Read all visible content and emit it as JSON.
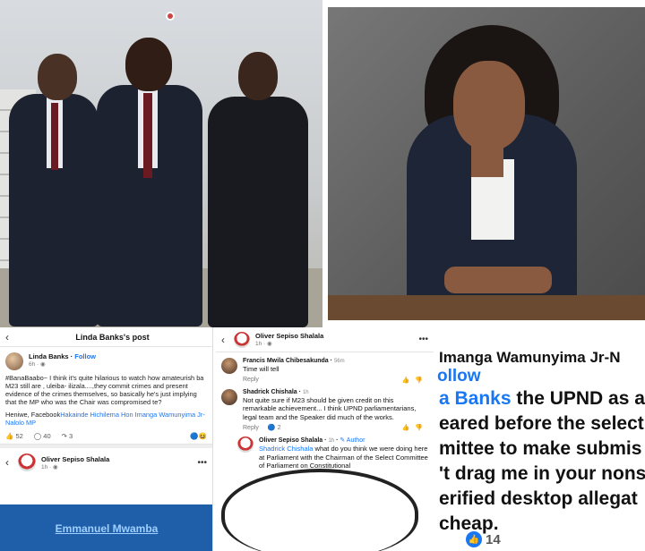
{
  "left_post": {
    "header_title": "Linda Banks's post",
    "author": "Linda Banks",
    "follow": "Follow",
    "time": "6h",
    "text": "#BanaBaabo~ I think it's quite hilarious to watch how amateurish ba M23  still are , uleiba- ilizala....,they commit crimes and present evidence of the crimes themselves, so basically he's just implying that the MP who was the Chair was compromised te?",
    "text2_prefix": "Heniwe, Facebook",
    "text2_mention": "Hakainde Hichilema Hon Imanga Wamunyima Jr-Nalolo MP",
    "likes": "52",
    "comments": "40",
    "shares": "3",
    "share_author": "Oliver Sepiso Shalala",
    "share_time": "1h",
    "blue_text": "Emmanuel Mwamba"
  },
  "comments": {
    "top_author": "Oliver Sepiso Shalala",
    "top_time": "1h",
    "items": [
      {
        "name": "Francis Mwila Chibesakunda",
        "time": "56m",
        "text": "Time will tell",
        "reply": "Reply"
      },
      {
        "name": "Shadrick Chishala",
        "time": "1h",
        "text": "Not quite sure if M23 should be given credit on this remarkable achievement... I think UPND parliamentarians, legal team and the Speaker did much of the works.",
        "reply": "Reply",
        "count": "2"
      },
      {
        "name": "Oliver Sepiso Shalala",
        "time": "1h",
        "badge": "Author",
        "mention": "Shadrick Chishala",
        "text": " what do you think we were doing here at Parliament with the Chairman of the Select Committee of Parliament on Constitutional"
      }
    ]
  },
  "zoom": {
    "line1": "Imanga Wamunyima Jr-N",
    "follow": "ollow",
    "line3_mention": "a Banks",
    "line3_rest": " the UPND as a",
    "line4": "eared before the select",
    "line5": "mittee to make submis",
    "line6": "'t drag me in your nons",
    "line7": "erified desktop allegat",
    "line8": "cheap.",
    "likes": "14"
  }
}
